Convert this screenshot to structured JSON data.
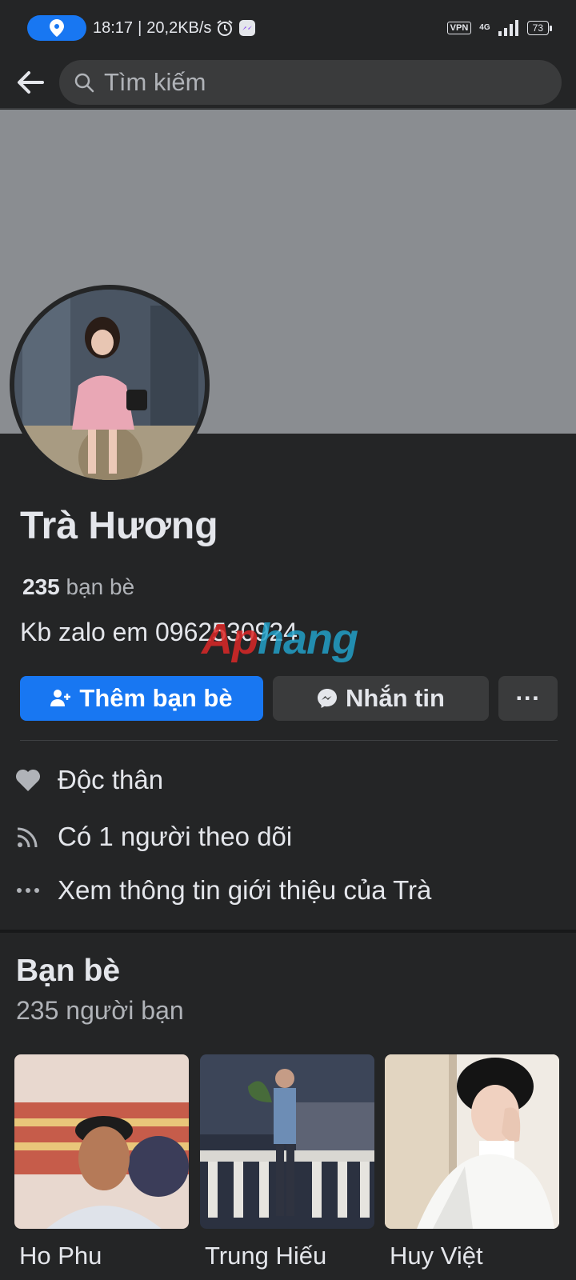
{
  "status_bar": {
    "time": "18:17",
    "net_speed": "20,2KB/s",
    "vpn": "VPN",
    "network": "4G",
    "battery": "73",
    "accent_color": "#1877f2"
  },
  "search": {
    "placeholder": "Tìm kiếm"
  },
  "profile": {
    "name": "Trà Hương",
    "friends_count": "235",
    "friends_label": "bạn bè",
    "bio": "Kb zalo em 0962530924",
    "watermark": {
      "part1": "Ap",
      "part2": "hang"
    }
  },
  "actions": {
    "add_friend": "Thêm bạn bè",
    "message": "Nhắn tin",
    "more": "···"
  },
  "info": {
    "relationship": "Độc thân",
    "followers": "Có 1 người theo dõi",
    "about": "Xem thông tin giới thiệu của Trà"
  },
  "friends_section": {
    "title": "Bạn bè",
    "count_text": "235 người bạn",
    "items": [
      {
        "name": "Ho Phu"
      },
      {
        "name": "Trung Hiếu"
      },
      {
        "name": "Huy Việt"
      }
    ]
  }
}
